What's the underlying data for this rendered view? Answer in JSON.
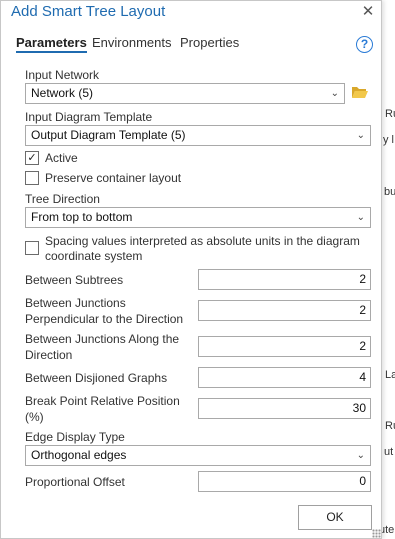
{
  "dialog": {
    "title": "Add Smart Tree Layout",
    "close_glyph": "✕",
    "tabs": [
      {
        "label": "Parameters"
      },
      {
        "label": "Environments"
      },
      {
        "label": "Properties"
      }
    ],
    "help_glyph": "?"
  },
  "params": {
    "input_network": {
      "label": "Input Network",
      "value": "Network (5)"
    },
    "diagram_template": {
      "label": "Input Diagram Template",
      "value": "Output Diagram Template (5)"
    },
    "active": {
      "label": "Active",
      "checked": true
    },
    "preserve": {
      "label": "Preserve container layout",
      "checked": false
    },
    "tree_direction": {
      "label": "Tree Direction",
      "value": "From top to bottom"
    },
    "spacing_absolute": {
      "label": "Spacing values interpreted as absolute units in the diagram coordinate system",
      "checked": false
    },
    "between_subtrees": {
      "label": "Between Subtrees",
      "value": "2"
    },
    "between_junctions_perp": {
      "label": "Between Junctions Perpendicular to the Direction",
      "value": "2"
    },
    "between_junctions_along": {
      "label": "Between Junctions Along the Direction",
      "value": "2"
    },
    "between_disjoined": {
      "label": "Between Disjioned Graphs",
      "value": "4"
    },
    "break_point": {
      "label": "Break Point Relative Position (%)",
      "value": "30"
    },
    "edge_display": {
      "label": "Edge Display Type",
      "value": "Orthogonal edges"
    },
    "proportional_offset": {
      "label": "Proportional Offset",
      "value": "0"
    }
  },
  "footer": {
    "ok_label": "OK"
  },
  "background": {
    "frags": [
      "Ru",
      "y l",
      "bu",
      "La",
      "Ru",
      "ut",
      "ute"
    ],
    "left_frag": "e"
  },
  "icons": {
    "select_chevron": "⌄",
    "check_mark": "✓"
  }
}
